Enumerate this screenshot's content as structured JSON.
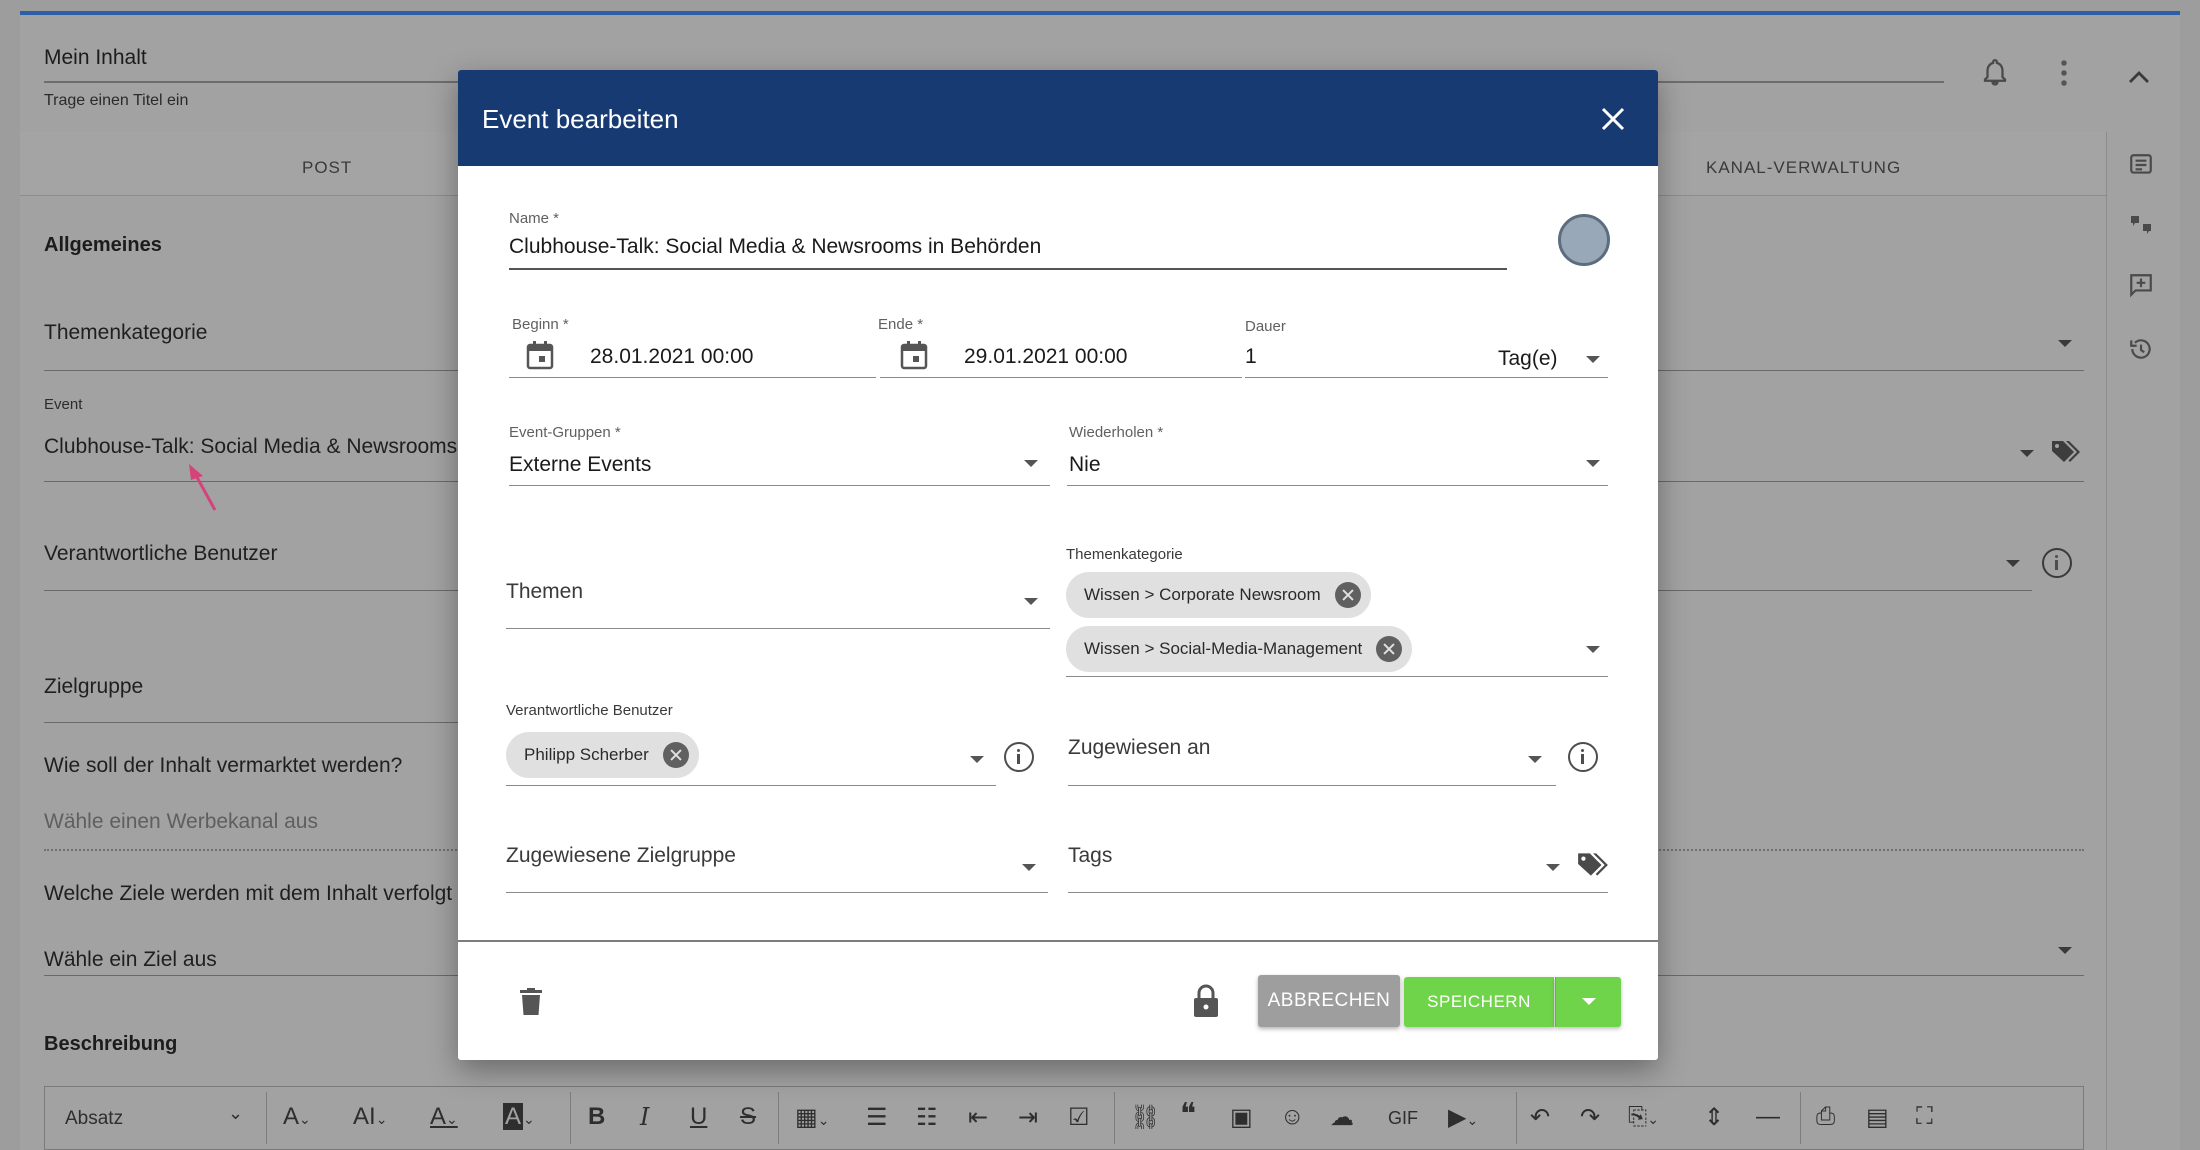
{
  "background": {
    "title": "Mein Inhalt",
    "title_hint": "Trage einen Titel ein",
    "tabs": [
      "POST",
      "KANAL-VERWALTUNG"
    ],
    "section_general": "Allgemeines",
    "theme_category_label": "Themenkategorie",
    "event_label": "Event",
    "event_value": "Clubhouse-Talk: Social Media & Newsrooms",
    "responsible_users_label": "Verantwortliche Benutzer",
    "target_group_label": "Zielgruppe",
    "marketing_question": "Wie soll der Inhalt vermarktet werden?",
    "marketing_placeholder": "Wähle einen Werbekanal aus",
    "goals_question": "Welche Ziele werden mit dem Inhalt verfolgt",
    "goals_placeholder": "Wähle ein Ziel aus",
    "description_label": "Beschreibung",
    "toolbar": {
      "paragraph_select": "Absatz",
      "gif_label": "GIF"
    },
    "accent_color": "#2f5ea8"
  },
  "modal": {
    "title": "Event bearbeiten",
    "name_label": "Name *",
    "name_value": "Clubhouse-Talk: Social Media & Newsrooms in Behörden",
    "start_label": "Beginn *",
    "start_value": "28.01.2021 00:00",
    "end_label": "Ende *",
    "end_value": "29.01.2021 00:00",
    "duration_label": "Dauer",
    "duration_value": "1",
    "duration_unit": "Tag(e)",
    "event_groups_label": "Event-Gruppen *",
    "event_groups_value": "Externe Events",
    "repeat_label": "Wiederholen *",
    "repeat_value": "Nie",
    "themes_placeholder": "Themen",
    "theme_category_label": "Themenkategorie",
    "theme_category_chips": [
      "Wissen > Corporate Newsroom",
      "Wissen > Social-Media-Management"
    ],
    "responsible_users_label": "Verantwortliche Benutzer",
    "responsible_users_chips": [
      "Philipp Scherber"
    ],
    "assigned_to_placeholder": "Zugewiesen an",
    "assigned_target_group_placeholder": "Zugewiesene Zielgruppe",
    "tags_placeholder": "Tags",
    "cancel_label": "ABBRECHEN",
    "save_label": "SPEICHERN",
    "header_color": "#173a73",
    "save_color": "#70d44b",
    "event_color": "#98a8b8"
  }
}
